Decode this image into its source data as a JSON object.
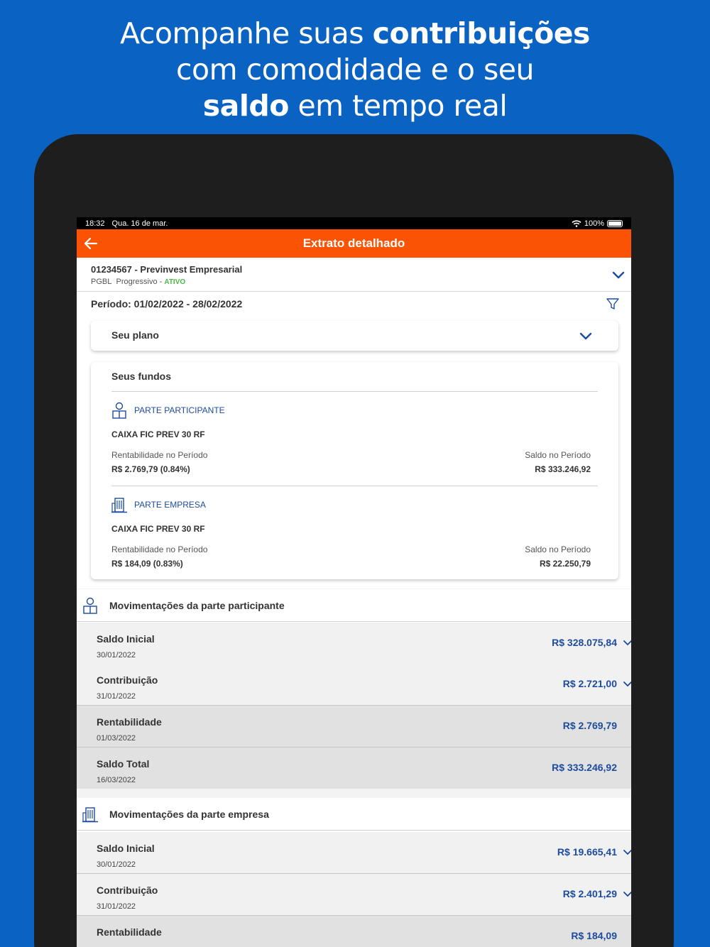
{
  "headline": {
    "line1_normal": "Acompanhe suas ",
    "line1_bold": "contribuições",
    "line2": "com comodidade e o seu",
    "line3_bold": "saldo",
    "line3_normal": " em tempo real"
  },
  "statusbar": {
    "time": "18:32",
    "date": "Qua. 16 de mar.",
    "battery": "100%"
  },
  "appbar": {
    "title": "Extrato detalhado"
  },
  "plan": {
    "name": "01234567 - Previnvest Empresarial",
    "type": "PGBL",
    "regime": "Progressivo",
    "separator": " - ",
    "status": "ATIVO",
    "status_color": "#4cb944"
  },
  "period": {
    "text": "Período: 01/02/2022  -  28/02/2022"
  },
  "seu_plano": {
    "label": "Seu plano"
  },
  "seus_fundos": {
    "label": "Seus fundos",
    "funds": [
      {
        "section": "PARTE PARTICIPANTE",
        "icon": "person-icon",
        "name": "CAIXA FIC PREV 30 RF",
        "rent_label": "Rentabilidade no Período",
        "rent_value": "R$ 2.769,79 (0.84%)",
        "saldo_label": "Saldo no Período",
        "saldo_value": "R$ 333.246,92"
      },
      {
        "section": "PARTE EMPRESA",
        "icon": "building-icon",
        "name": "CAIXA FIC PREV 30 RF",
        "rent_label": "Rentabilidade no Período",
        "rent_value": "R$ 184,09 (0.83%)",
        "saldo_label": "Saldo no Período",
        "saldo_value": "R$ 22.250,79"
      }
    ]
  },
  "mov_participante": {
    "title": "Movimentações da parte participante",
    "rows": [
      {
        "title": "Saldo Inicial",
        "date": "30/01/2022",
        "amount": "R$ 328.075,84"
      },
      {
        "title": "Contribuição",
        "date": "31/01/2022",
        "amount": "R$ 2.721,00"
      },
      {
        "title": "Rentabilidade",
        "date": "01/03/2022",
        "amount": "R$ 2.769,79"
      },
      {
        "title": "Saldo Total",
        "date": "16/03/2022",
        "amount": "R$ 333.246,92"
      }
    ]
  },
  "mov_empresa": {
    "title": "Movimentações da parte empresa",
    "rows": [
      {
        "title": "Saldo Inicial",
        "date": "30/01/2022",
        "amount": "R$ 19.665,41"
      },
      {
        "title": "Contribuição",
        "date": "31/01/2022",
        "amount": "R$ 2.401,29"
      },
      {
        "title": "Rentabilidade",
        "date": "",
        "amount": "R$ 184,09"
      }
    ]
  },
  "colors": {
    "background": "#0a62c2",
    "appbar": "#fb5304",
    "accent_blue": "#1d4b9e"
  }
}
